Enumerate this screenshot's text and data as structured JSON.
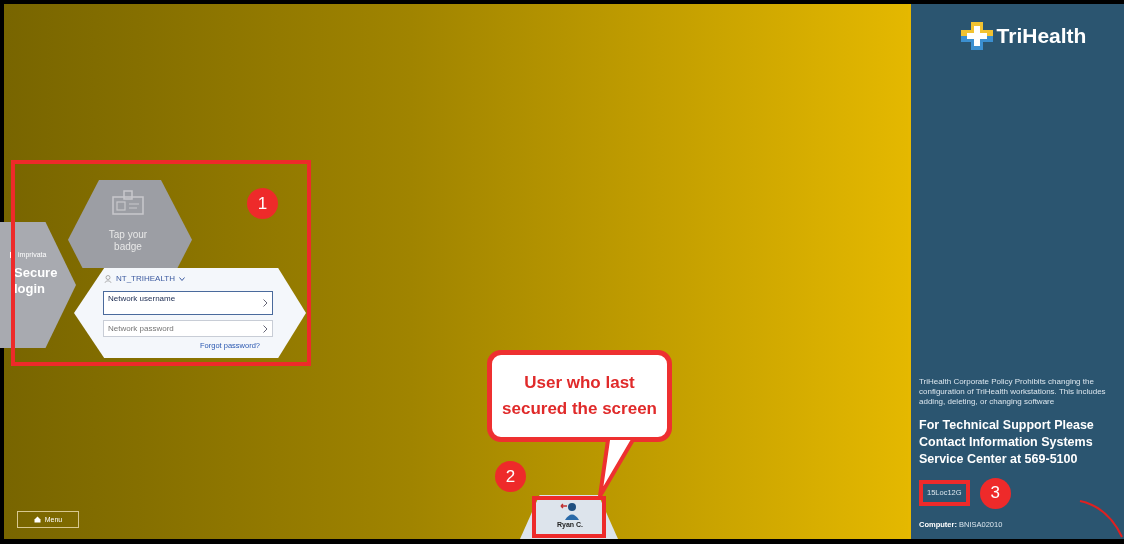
{
  "login": {
    "brand": "imprivata",
    "title": "Secure login",
    "badge_prompt": "Tap your badge",
    "domain": "NT_TRIHEALTH",
    "username_label": "Network username",
    "password_placeholder": "Network password",
    "forgot_link": "Forgot password?"
  },
  "menu_button": "Menu",
  "last_user": {
    "name": "Ryan C."
  },
  "side_panel": {
    "brand": "TriHealth",
    "policy": "TriHealth Corporate Policy Prohibits changing the configuration of TriHealth workstations. This includes adding, deleting, or changing software",
    "support": "For Technical Support Please Contact Information Systems Service Center at 569-5100",
    "location": "15Loc12G",
    "computer_label": "Computer:",
    "computer": "BNISA02010"
  },
  "annotations": {
    "callout": "User who last secured the screen",
    "markers": [
      "1",
      "2",
      "3"
    ]
  }
}
